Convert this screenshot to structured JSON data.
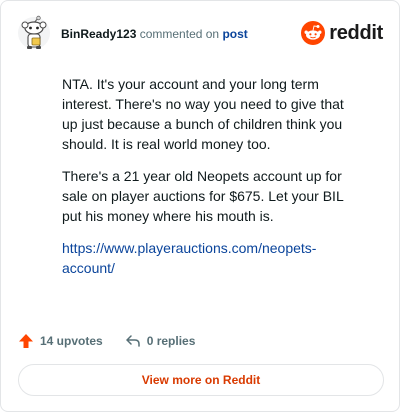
{
  "header": {
    "username": "BinReady123",
    "action_text": "commented on",
    "target_link": "post",
    "logo_text": "reddit"
  },
  "comment": {
    "paragraphs": [
      "NTA. It's your account and your long term interest. There's no way you need to give that up just because a bunch of children think you should. It is real world money too.",
      "There's a 21 year old Neopets account up for sale on player auctions for $675. Let your BIL put his money where his mouth is."
    ],
    "link": "https://www.playerauctions.com/neopets-account/"
  },
  "actions": {
    "upvotes": "14 upvotes",
    "replies": "0 replies"
  },
  "footer": {
    "view_more": "View more on Reddit"
  },
  "colors": {
    "brand": "#ff4500",
    "link": "#0a449b",
    "view_more": "#d93a00"
  },
  "icons": [
    "avatar-snoo-icon",
    "reddit-logo-icon",
    "upvote-arrow-icon",
    "reply-arrow-icon"
  ]
}
